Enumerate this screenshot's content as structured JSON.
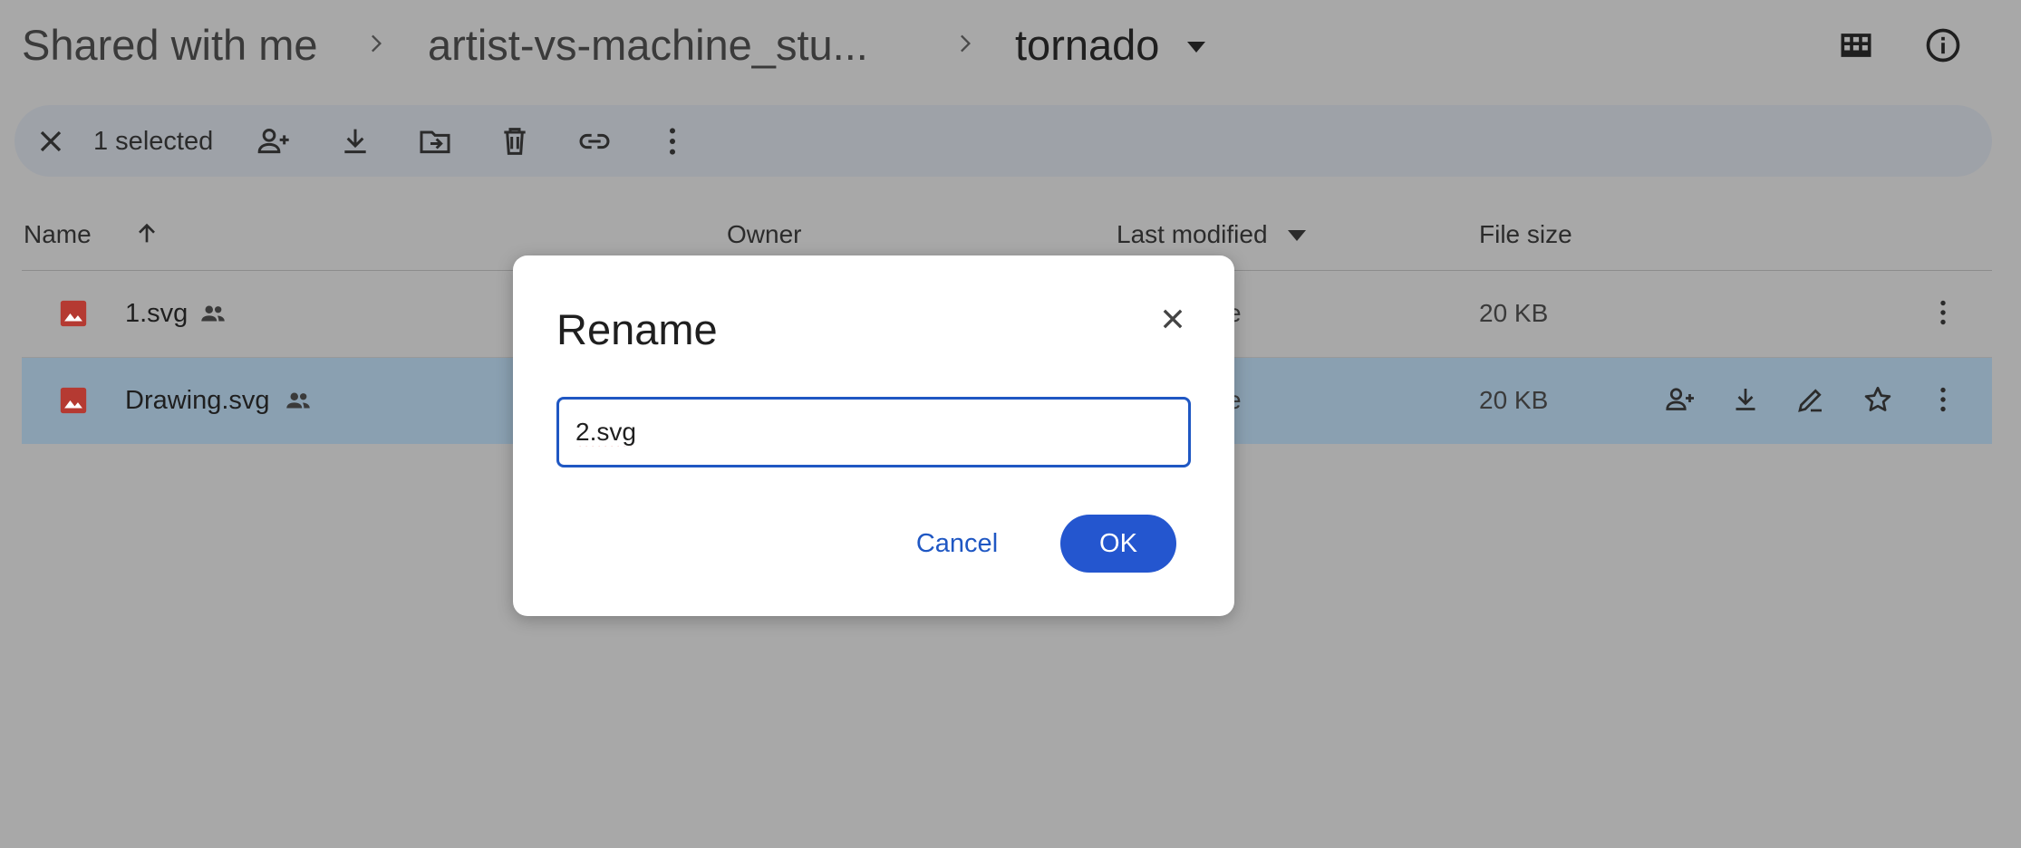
{
  "header": {
    "breadcrumbs": [
      "Shared with me",
      "artist-vs-machine_stu...",
      "tornado"
    ],
    "icons": [
      "grid-view-icon",
      "info-icon"
    ]
  },
  "toolbar": {
    "selected_count": "1 selected",
    "icons": [
      "close-icon",
      "share-person-icon",
      "download-icon",
      "move-to-folder-icon",
      "trash-icon",
      "link-icon",
      "more-vert-icon"
    ]
  },
  "list": {
    "columns": {
      "name": "Name",
      "owner": "Owner",
      "last_modified": "Last modified",
      "file_size": "File size"
    },
    "rows": [
      {
        "name": "1.svg",
        "last_modified": "e",
        "size": "20 KB",
        "selected": false
      },
      {
        "name": "Drawing.svg",
        "last_modified": "e",
        "size": "20 KB",
        "selected": true
      }
    ]
  },
  "dialog": {
    "title": "Rename",
    "input_value": "2.svg",
    "cancel_label": "Cancel",
    "ok_label": "OK"
  },
  "colors": {
    "overlay_bg": "#a8a8a8",
    "accent": "#2456cf",
    "selected_row": "#8aa0b1",
    "file_icon": "#c5221f"
  }
}
